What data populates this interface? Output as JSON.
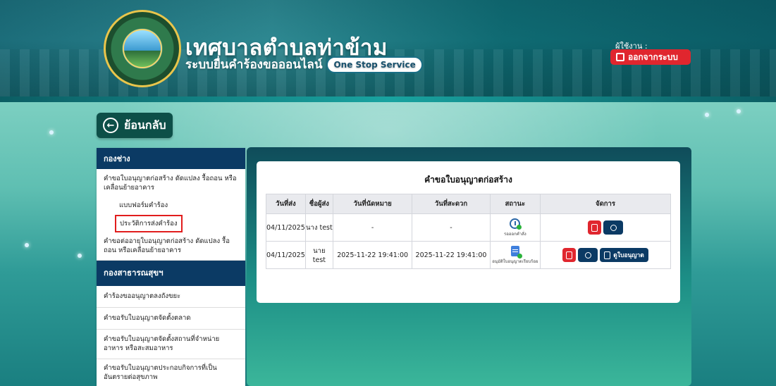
{
  "header": {
    "site_title": "เทศบาลตำบลท่าข้าม",
    "site_subtitle": "ระบบยื่นคำร้องขอออนไลน์",
    "service_badge": "One Stop Service",
    "user_label": "ผู้ใช้งาน :",
    "logout_label": "ออกจากระบบ"
  },
  "nav": {
    "back_label": "ย้อนกลับ"
  },
  "sidebar": {
    "sections": [
      {
        "title": "กองช่าง",
        "items": [
          {
            "label": "คำขอใบอนุญาตก่อสร้าง ดัดแปลง รื้อถอน หรือเคลื่อนย้ายอาคาร"
          },
          {
            "label": "แบบฟอร์มคำร้อง"
          },
          {
            "label": "ประวัติการส่งคำร้อง"
          },
          {
            "label": "คำขอต่ออายุใบอนุญาตก่อสร้าง ดัดแปลง รื้อถอน หรือเคลื่อนย้ายอาคาร"
          }
        ]
      },
      {
        "title": "กองสาธารณสุขฯ",
        "items": [
          {
            "label": "คำร้องขออนุญาตลงถังขยะ"
          },
          {
            "label": "คำขอรับใบอนุญาตจัดตั้งตลาด"
          },
          {
            "label": "คำขอรับใบอนุญาตจัดตั้งสถานที่จำหน่ายอาหาร หรือสะสมอาหาร"
          },
          {
            "label": "คำขอรับใบอนุญาตประกอบกิจการที่เป็นอันตรายต่อสุขภาพ"
          }
        ]
      }
    ]
  },
  "main": {
    "card_title": "คำขอใบอนุญาตก่อสร้าง",
    "columns": [
      "วันที่ส่ง",
      "ชื่อผู้ส่ง",
      "วันที่นัดหมาย",
      "วันที่สะดวก",
      "สถานะ",
      "จัดการ"
    ],
    "rows": [
      {
        "sent_date": "04/11/2025",
        "sender": "นาง test",
        "appointment": "-",
        "convenient": "-",
        "status_text": "รอออกคำสั่ง",
        "status_icon": "clock-icon"
      },
      {
        "sent_date": "04/11/2025",
        "sender": "นาย test",
        "appointment": "2025-11-22 19:41:00",
        "convenient": "2025-11-22 19:41:00",
        "status_text": "อนุมัติใบอนุญาตเรียบร้อย",
        "status_icon": "document-approved-icon",
        "view_label": "ดูใบอนุญาต"
      }
    ]
  },
  "colors": {
    "accent_navy": "#0b3a64",
    "danger_red": "#e0262e",
    "highlight_border": "#e11d1d"
  }
}
